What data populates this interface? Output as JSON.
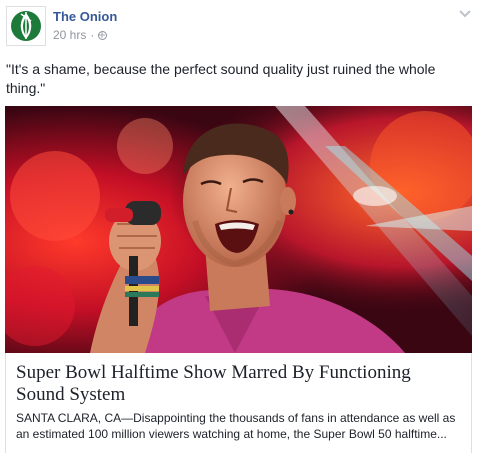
{
  "post": {
    "page_name": "The Onion",
    "timestamp": "20 hrs",
    "separator": "·",
    "status_text": "\"It's a shame, because the perfect sound quality just ruined the whole thing.\"",
    "link": {
      "title": "Super Bowl Halftime Show Marred By Functioning Sound System",
      "description": "SANTA CLARA, CA—Disappointing the thousands of fans in attendance as well as an estimated 100 million viewers watching at home, the Super Bowl 50 halftime..."
    },
    "icons": {
      "avatar": "onion-logo",
      "privacy": "globe-icon",
      "menu": "chevron-down-icon"
    },
    "colors": {
      "page_name": "#365899",
      "logo_green": "#1e7a3a",
      "meta_gray": "#90949c"
    }
  }
}
